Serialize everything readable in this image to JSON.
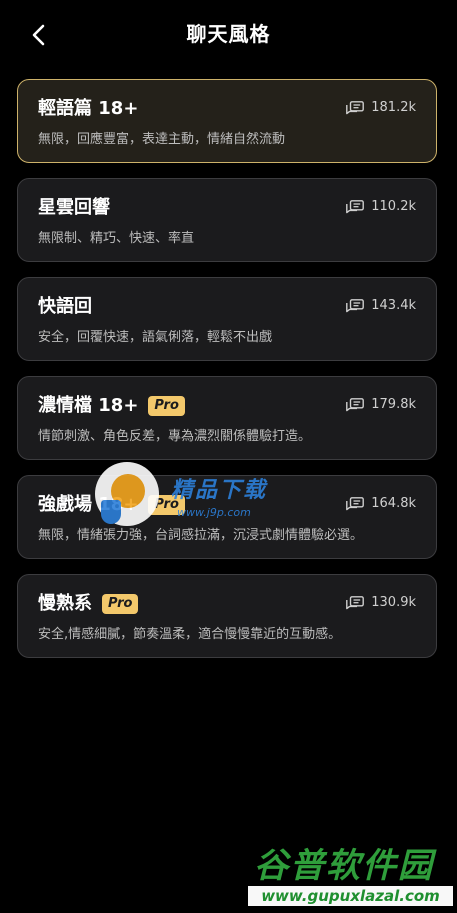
{
  "header": {
    "title": "聊天風格"
  },
  "styles": [
    {
      "name": "輕語篇 18+",
      "pro": false,
      "desc": "無限，回應豐富，表達主動，情緒自然流動",
      "count": "181.2k",
      "selected": true
    },
    {
      "name": "星雲回響",
      "pro": false,
      "desc": "無限制、精巧、快速、率直",
      "count": "110.2k",
      "selected": false
    },
    {
      "name": "快語回",
      "pro": false,
      "desc": "安全，回覆快速，語氣俐落，輕鬆不出戲",
      "count": "143.4k",
      "selected": false
    },
    {
      "name": "濃情檔 18+",
      "pro": true,
      "pro_label": "Pro",
      "desc": "情節刺激、角色反差，專為濃烈關係體驗打造。",
      "count": "179.8k",
      "selected": false
    },
    {
      "name": "強戲場 18+",
      "pro": true,
      "pro_label": "Pro",
      "desc": "無限，情緒張力強，台詞感拉滿，沉浸式劇情體驗必選。",
      "count": "164.8k",
      "selected": false
    },
    {
      "name": "慢熟系",
      "pro": true,
      "pro_label": "Pro",
      "desc": "安全,情感細膩，節奏溫柔，適合慢慢靠近的互動感。",
      "count": "130.9k",
      "selected": false
    }
  ],
  "watermarks": {
    "top_text": "精品下载",
    "top_url": "www.j9p.com",
    "bottom_text": "谷普软件园",
    "bottom_url": "www.gupuxlazal.com"
  },
  "colors": {
    "background": "#000000",
    "card": "#1b1b1d",
    "selected_border": "#cdb26a",
    "pro_badge": "#f3c86b"
  },
  "icons": {
    "back": "chevron-left-icon",
    "count": "chat-bubbles-icon"
  }
}
